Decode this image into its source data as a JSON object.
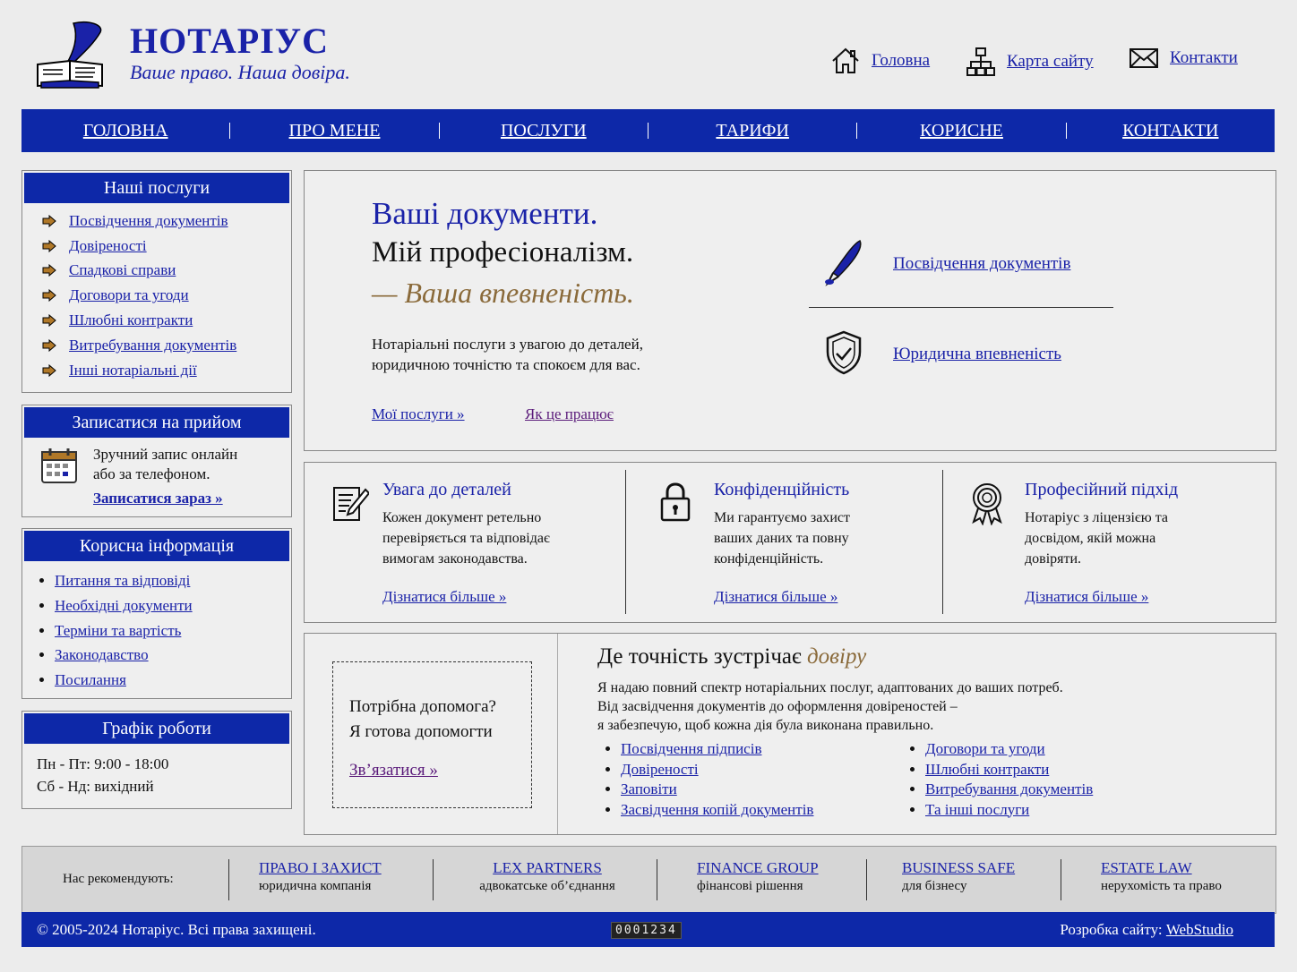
{
  "header": {
    "brand": "НОТАРІУС",
    "tagline": "Ваше право. Наша довіра.",
    "links": [
      {
        "label": "Головна",
        "icon": "home-icon"
      },
      {
        "label": "Карта сайту",
        "icon": "sitemap-icon"
      },
      {
        "label": "Контакти",
        "icon": "mail-icon"
      }
    ]
  },
  "nav": [
    "ГОЛОВНА",
    "ПРО МЕНЕ",
    "ПОСЛУГИ",
    "ТАРИФИ",
    "КОРИСНЕ",
    "КОНТАКТИ"
  ],
  "sidebar": {
    "services": {
      "title": "Наші послуги",
      "items": [
        "Посвідчення документів",
        "Довіреності",
        "Спадкові справи",
        "Договори та угоди",
        "Шлюбні контракти",
        "Витребування документів",
        "Інші нотаріальні дії"
      ]
    },
    "appointment": {
      "title": "Записатися на прийом",
      "text1": "Зручний запис онлайн",
      "text2": "або за телефоном.",
      "link": "Записатися зараз »"
    },
    "info": {
      "title": "Корисна інформація",
      "items": [
        "Питання та відповіді",
        "Необхідні документи",
        "Терміни та вартість",
        "Законодавство",
        "Посилання"
      ]
    },
    "schedule": {
      "title": "Графік роботи",
      "line1": "Пн - Пт: 9:00 - 18:00",
      "line2": "Сб - Нд: вихідний"
    }
  },
  "hero": {
    "line1": "Ваші документи.",
    "line2": "Мій професіоналізм.",
    "line3": "— Ваша впевненість.",
    "desc1": "Нотаріальні послуги з увагою до деталей,",
    "desc2": "юридичною точністю та спокоєм для вас.",
    "link1": "Мої послуги »",
    "link2": "Як це працює",
    "right_link1": "Посвідчення документів",
    "right_link2": "Юридична впевненість"
  },
  "features": [
    {
      "title": "Увага до деталей",
      "l1": "Кожен документ ретельно",
      "l2": "перевіряється та відповідає",
      "l3": "вимогам законодавства.",
      "link": "Дізнатися більше »"
    },
    {
      "title": "Конфіденційність",
      "l1": "Ми гарантуємо захист",
      "l2": "ваших даних та повну",
      "l3": "конфіденційність.",
      "link": "Дізнатися більше »"
    },
    {
      "title": "Професійний підхід",
      "l1": "Нотаріус з ліцензією та",
      "l2": "досвідом, якій можна",
      "l3": "довіряти.",
      "link": "Дізнатися більше »"
    }
  ],
  "help": {
    "line1": "Потрібна допомога?",
    "line2": "Я готова допомогти",
    "link": "Зв’язатися »"
  },
  "precision": {
    "title_main": "Де точність зустрічає",
    "title_accent": "довіру",
    "p1": "Я надаю повний спектр нотаріальних послуг, адаптованих до ваших потреб.",
    "p2": "Від засвідчення документів до оформлення довіреностей –",
    "p3": "я забезпечую, щоб кожна дія була виконана правильно.",
    "col1": [
      "Посвідчення підписів",
      "Довіреності",
      "Заповіти",
      "Засвідчення копій документів"
    ],
    "col2": [
      "Договори та угоди",
      "Шлюбні контракти",
      "Витребування документів",
      "Та інші послуги"
    ]
  },
  "partners": {
    "label": "Нас рекомендують:",
    "items": [
      {
        "name": "ПРАВО І ЗАХИСТ",
        "sub": "юридична компанія"
      },
      {
        "name": "LEX PARTNERS",
        "sub": "адвокатське об’єднання"
      },
      {
        "name": "FINANCE GROUP",
        "sub": "фінансові рішення"
      },
      {
        "name": "BUSINESS SAFE",
        "sub": "для бізнесу"
      },
      {
        "name": "ESTATE LAW",
        "sub": "нерухомість та право"
      }
    ]
  },
  "footer": {
    "copyright": "© 2005-2024 Нотаріус. Всі права захищені.",
    "counter": "0001234",
    "dev_label": "Розробка сайту:",
    "dev_link": "WebStudio"
  },
  "colors": {
    "primary": "#0d28a8",
    "accent": "#8a6a3a",
    "link": "#1a22a8",
    "visited": "#5a1a7a"
  }
}
